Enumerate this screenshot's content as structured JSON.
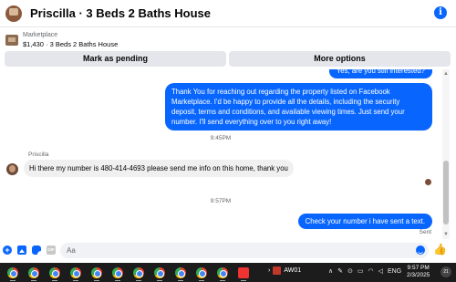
{
  "header": {
    "title": "Priscilla · 3 Beds 2 Baths House",
    "info_glyph": "i"
  },
  "listing": {
    "category": "Marketplace",
    "summary": "$1,430 · 3 Beds 2 Baths House"
  },
  "actions": {
    "mark_pending": "Mark as pending",
    "more_options": "More options"
  },
  "messages": {
    "partial_out": "Yes, are you still interested?",
    "long_out": "Thank You for reaching out regarding the property listed on Facebook Marketplace. I'd be happy to provide all the details, including the security deposit, terms and conditions, and available viewing times. Just send your number. I'll send everything over to you right away!",
    "time1": "9:45PM",
    "sender_name": "Priscilla",
    "incoming": "Hi there my number is 480-414-4693 please send me info on this home, thank you",
    "time2": "9:57PM",
    "short_out": "Check your number i have sent a text.",
    "sent_status": "Sent"
  },
  "composer": {
    "placeholder": "Aa",
    "gif_label": "GIF",
    "plus_glyph": "+"
  },
  "taskbar": {
    "window_label": "AW01",
    "language": "ENG",
    "time": "9:57 PM",
    "date": "2/3/2025",
    "notification_count": "21"
  },
  "colors": {
    "accent": "#0866ff",
    "bubble_in": "#f0f0f0",
    "taskbar": "#1c1c1c"
  },
  "icons": [
    "info-icon",
    "plus-icon",
    "image-icon",
    "sticker-icon",
    "gif-icon",
    "emoji-icon",
    "like-icon",
    "chrome-icon",
    "wifi-icon",
    "speaker-icon",
    "battery-icon"
  ]
}
